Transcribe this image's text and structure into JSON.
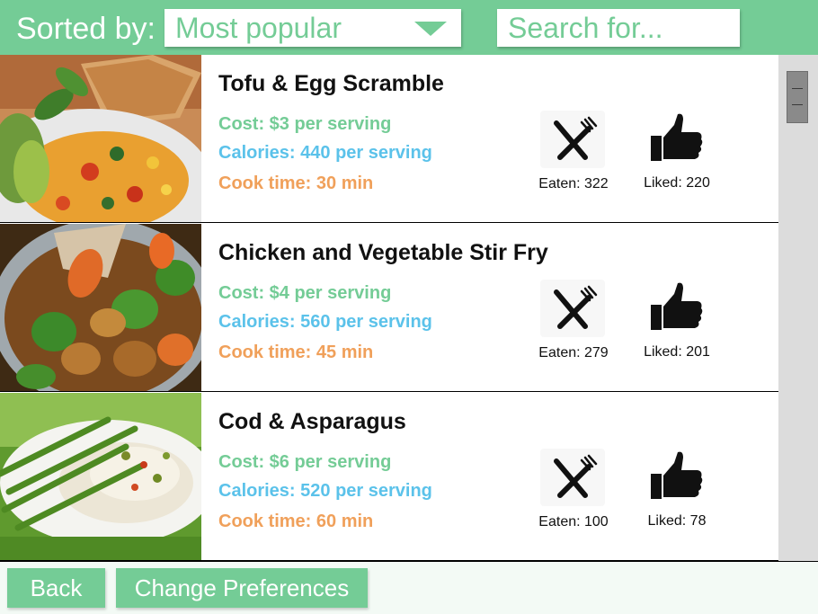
{
  "header": {
    "sorted_by_label": "Sorted by:",
    "sort_value": "Most popular",
    "search_placeholder": "Search for..."
  },
  "recipes": [
    {
      "title": "Tofu & Egg Scramble",
      "cost": "Cost: $3 per serving",
      "calories": "Calories: 440 per serving",
      "cook_time": "Cook time: 30 min",
      "eaten": "Eaten: 322",
      "liked": "Liked: 220"
    },
    {
      "title": "Chicken and Vegetable Stir Fry",
      "cost": "Cost: $4 per serving",
      "calories": "Calories: 560 per serving",
      "cook_time": "Cook time: 45 min",
      "eaten": "Eaten: 279",
      "liked": "Liked: 201"
    },
    {
      "title": "Cod & Asparagus",
      "cost": "Cost: $6 per serving",
      "calories": "Calories: 520 per serving",
      "cook_time": "Cook time: 60 min",
      "eaten": "Eaten: 100",
      "liked": "Liked: 78"
    }
  ],
  "icons": {
    "sort_caret": "triangle-down-icon",
    "eat": "fork-knife-icon",
    "like": "thumbs-up-icon"
  },
  "footer": {
    "back_label": "Back",
    "preferences_label": "Change Preferences"
  },
  "colors": {
    "brand_green": "#74cc96",
    "calories_blue": "#5bc2ea",
    "cook_orange": "#f0a05a"
  }
}
